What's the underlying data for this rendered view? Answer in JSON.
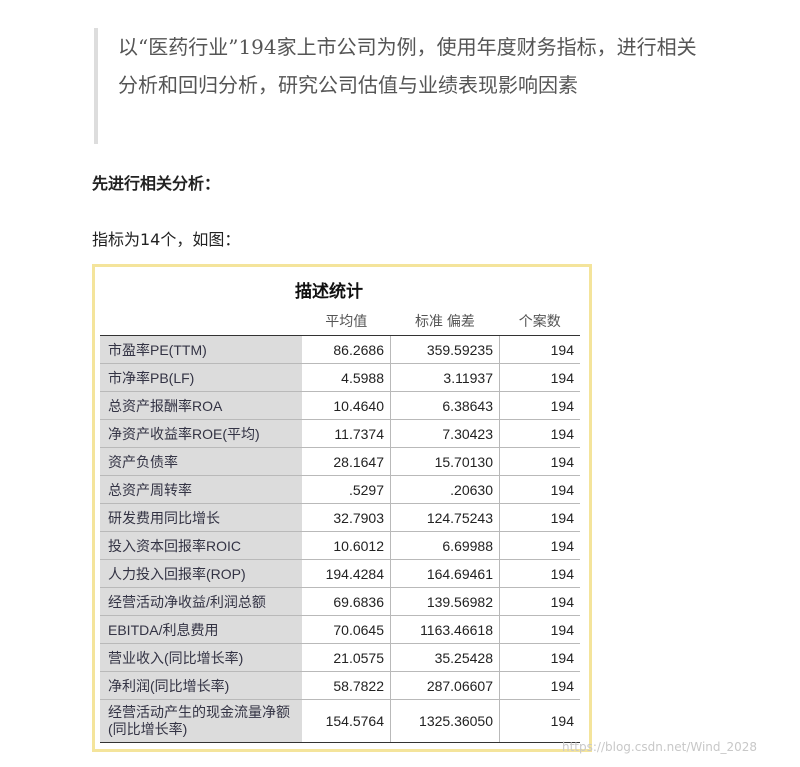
{
  "quote": {
    "text": "以“医药行业”194家上市公司为例，使用年度财务指标，进行相关分析和回归分析，研究公司估值与业绩表现影响因素"
  },
  "heading": "先进行相关分析：",
  "intro": "指标为14个，如图：",
  "table": {
    "title": "描述统计",
    "headers": [
      "",
      "平均值",
      "标准 偏差",
      "个案数"
    ],
    "rows": [
      {
        "label": "市盈率PE(TTM)",
        "mean": "86.2686",
        "sd": "359.59235",
        "n": "194"
      },
      {
        "label": "市净率PB(LF)",
        "mean": "4.5988",
        "sd": "3.11937",
        "n": "194"
      },
      {
        "label": "总资产报酬率ROA",
        "mean": "10.4640",
        "sd": "6.38643",
        "n": "194"
      },
      {
        "label": "净资产收益率ROE(平均)",
        "mean": "11.7374",
        "sd": "7.30423",
        "n": "194"
      },
      {
        "label": "资产负债率",
        "mean": "28.1647",
        "sd": "15.70130",
        "n": "194"
      },
      {
        "label": "总资产周转率",
        "mean": ".5297",
        "sd": ".20630",
        "n": "194"
      },
      {
        "label": "研发费用同比增长",
        "mean": "32.7903",
        "sd": "124.75243",
        "n": "194"
      },
      {
        "label": "投入资本回报率ROIC",
        "mean": "10.6012",
        "sd": "6.69988",
        "n": "194"
      },
      {
        "label": "人力投入回报率(ROP)",
        "mean": "194.4284",
        "sd": "164.69461",
        "n": "194"
      },
      {
        "label": "经营活动净收益/利润总额",
        "mean": "69.6836",
        "sd": "139.56982",
        "n": "194"
      },
      {
        "label": "EBITDA/利息费用",
        "mean": "70.0645",
        "sd": "1163.46618",
        "n": "194"
      },
      {
        "label": "营业收入(同比增长率)",
        "mean": "21.0575",
        "sd": "35.25428",
        "n": "194"
      },
      {
        "label": "净利润(同比增长率)",
        "mean": "58.7822",
        "sd": "287.06607",
        "n": "194"
      },
      {
        "label": "经营活动产生的现金流量净额(同比增长率)",
        "mean": "154.5764",
        "sd": "1325.36050",
        "n": "194"
      }
    ]
  },
  "watermark": "https://blog.csdn.net/Wind_2028"
}
